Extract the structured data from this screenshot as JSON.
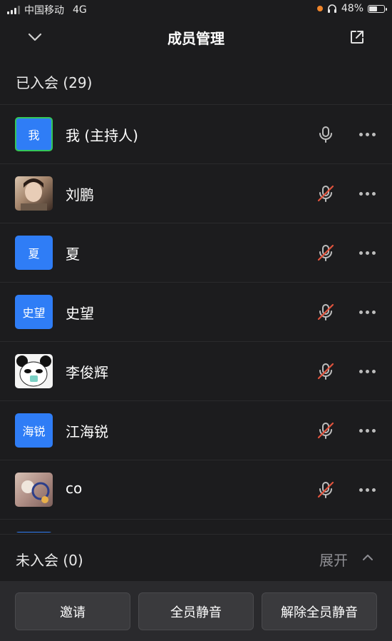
{
  "status_bar": {
    "carrier": "中国移动",
    "network": "4G",
    "battery": "48%",
    "battery_level": 0.48
  },
  "header": {
    "title": "成员管理",
    "collapse_icon": "chevron-down-icon",
    "popout_icon": "external-link-icon"
  },
  "joined": {
    "label": "已入会 (29)"
  },
  "members": [
    {
      "avatar_text": "我",
      "name": "我 (主持人)",
      "mic": "on"
    },
    {
      "avatar_text": "",
      "name": "刘鹏",
      "mic": "muted"
    },
    {
      "avatar_text": "夏",
      "name": "夏",
      "mic": "muted"
    },
    {
      "avatar_text": "史望",
      "name": "史望",
      "mic": "muted"
    },
    {
      "avatar_text": "",
      "name": "李俊辉",
      "mic": "muted"
    },
    {
      "avatar_text": "海锐",
      "name": "江海锐",
      "mic": "muted"
    },
    {
      "avatar_text": "",
      "name": "co",
      "mic": "muted"
    }
  ],
  "not_joined": {
    "label": "未入会 (0)",
    "expand": "展开"
  },
  "actions": {
    "invite": "邀请",
    "mute_all": "全员静音",
    "unmute_all": "解除全员静音"
  },
  "colors": {
    "accent": "#2f7df6",
    "host_border": "#34c759",
    "muted_red": "#e0533d",
    "background": "#1c1c1e"
  }
}
